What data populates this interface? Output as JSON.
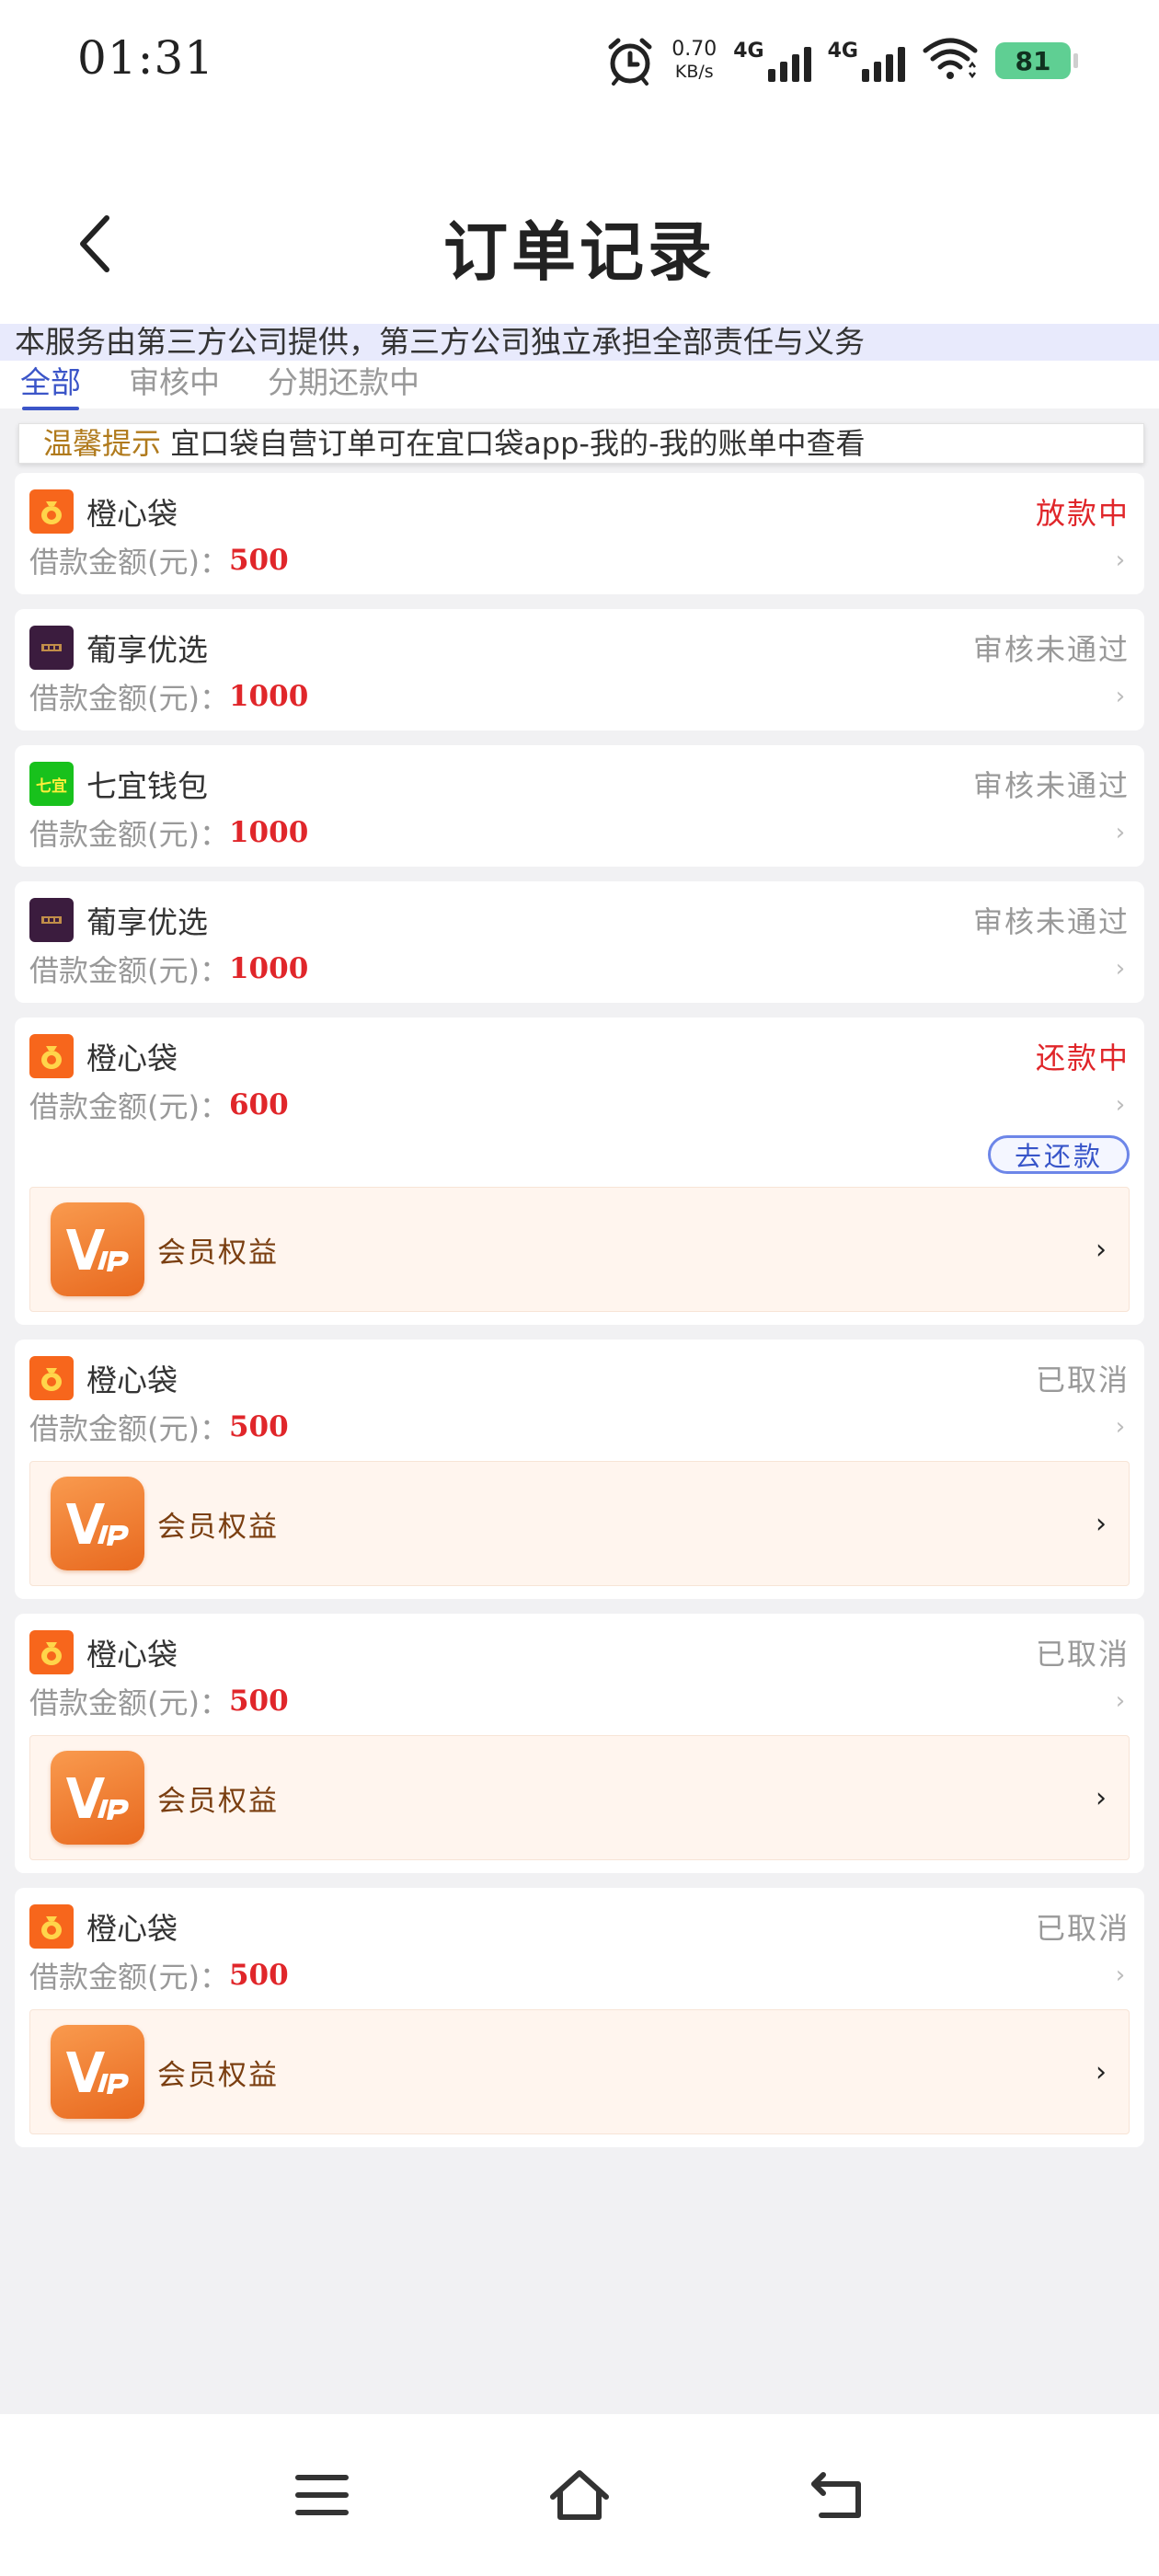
{
  "status_bar": {
    "time": "01:31",
    "speed_value": "0.70",
    "speed_unit": "KB/s",
    "network1": "4G",
    "network2": "4G",
    "battery": "81"
  },
  "header": {
    "title": "订单记录"
  },
  "notice": "本服务由第三方公司提供，第三方公司独立承担全部责任与义务",
  "tabs": [
    {
      "label": "全部",
      "active": true
    },
    {
      "label": "审核中",
      "active": false
    },
    {
      "label": "分期还款中",
      "active": false
    }
  ],
  "tip": {
    "label": "温馨提示",
    "text": "宜口袋自营订单可在宜口袋app-我的-我的账单中查看"
  },
  "amount_label": "借款金额(元)：",
  "orders": [
    {
      "name": "橙心袋",
      "status": "放款中",
      "amount": "500",
      "logo": "orange-bag-icon"
    },
    {
      "name": "葡享优选",
      "status": "审核未通过",
      "amount": "1000",
      "logo": "purple-brand-icon"
    },
    {
      "name": "七宜钱包",
      "status": "审核未通过",
      "amount": "1000",
      "logo": "green-brand-icon",
      "logo_text": "七宜"
    },
    {
      "name": "葡享优选",
      "status": "审核未通过",
      "amount": "1000",
      "logo": "purple-brand-icon"
    },
    {
      "name": "橙心袋",
      "status": "还款中",
      "amount": "600",
      "logo": "orange-bag-icon",
      "action": "去还款",
      "vip": "会员权益"
    },
    {
      "name": "橙心袋",
      "status": "已取消",
      "amount": "500",
      "logo": "orange-bag-icon",
      "vip": "会员权益"
    },
    {
      "name": "橙心袋",
      "status": "已取消",
      "amount": "500",
      "logo": "orange-bag-icon",
      "vip": "会员权益"
    },
    {
      "name": "橙心袋",
      "status": "已取消",
      "amount": "500",
      "logo": "orange-bag-icon",
      "vip": "会员权益"
    }
  ],
  "colors": {
    "accent_blue": "#3b55c8",
    "status_red": "#e0262a",
    "status_gray": "#999999",
    "vip_orange": "#e8691f"
  }
}
